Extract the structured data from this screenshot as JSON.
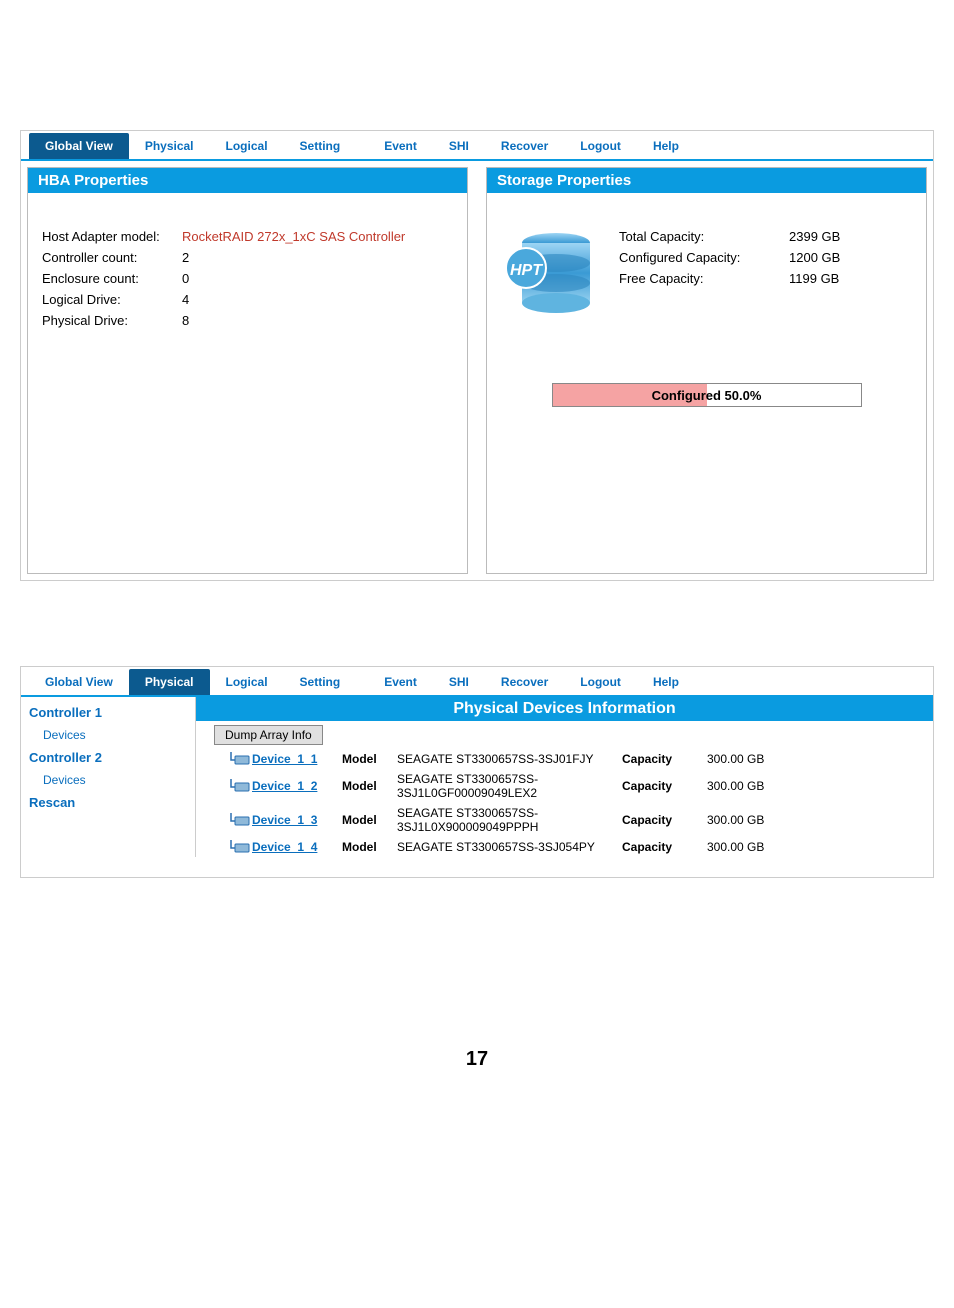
{
  "tabs1": {
    "items": [
      "Global View",
      "Physical",
      "Logical",
      "Setting",
      "Event",
      "SHI",
      "Recover",
      "Logout",
      "Help"
    ],
    "active": 0
  },
  "hba": {
    "title": "HBA Properties",
    "host_adapter_label": "Host Adapter model:",
    "host_adapter_value": "RocketRAID 272x_1xC SAS Controller",
    "controller_count_label": "Controller count:",
    "controller_count_value": "2",
    "enclosure_count_label": "Enclosure count:",
    "enclosure_count_value": "0",
    "logical_drive_label": "Logical Drive:",
    "logical_drive_value": "4",
    "physical_drive_label": "Physical Drive:",
    "physical_drive_value": "8"
  },
  "storage": {
    "title": "Storage Properties",
    "total_label": "Total Capacity:",
    "total_value": "2399 GB",
    "configured_label": "Configured Capacity:",
    "configured_value": "1200 GB",
    "free_label": "Free Capacity:",
    "free_value": "1199 GB",
    "progress_label": "Configured 50.0%",
    "progress_percent": 50,
    "icon_text": "HPT"
  },
  "tabs2": {
    "items": [
      "Global View",
      "Physical",
      "Logical",
      "Setting",
      "Event",
      "SHI",
      "Recover",
      "Logout",
      "Help"
    ],
    "active": 1
  },
  "sidebar": {
    "controller1": "Controller 1",
    "devices1": "Devices",
    "controller2": "Controller 2",
    "devices2": "Devices",
    "rescan": "Rescan"
  },
  "physical": {
    "banner": "Physical Devices Information",
    "dump_btn": "Dump Array Info",
    "label_model": "Model",
    "label_capacity": "Capacity",
    "devices": [
      {
        "name": "Device_1_1",
        "model": "SEAGATE ST3300657SS-3SJ01FJY",
        "capacity": "300.00 GB"
      },
      {
        "name": "Device_1_2",
        "model": "SEAGATE ST3300657SS-3SJ1L0GF00009049LEX2",
        "capacity": "300.00 GB"
      },
      {
        "name": "Device_1_3",
        "model": "SEAGATE ST3300657SS-3SJ1L0X900009049PPPH",
        "capacity": "300.00 GB"
      },
      {
        "name": "Device_1_4",
        "model": "SEAGATE ST3300657SS-3SJ054PY",
        "capacity": "300.00 GB"
      }
    ]
  },
  "page_number": "17"
}
